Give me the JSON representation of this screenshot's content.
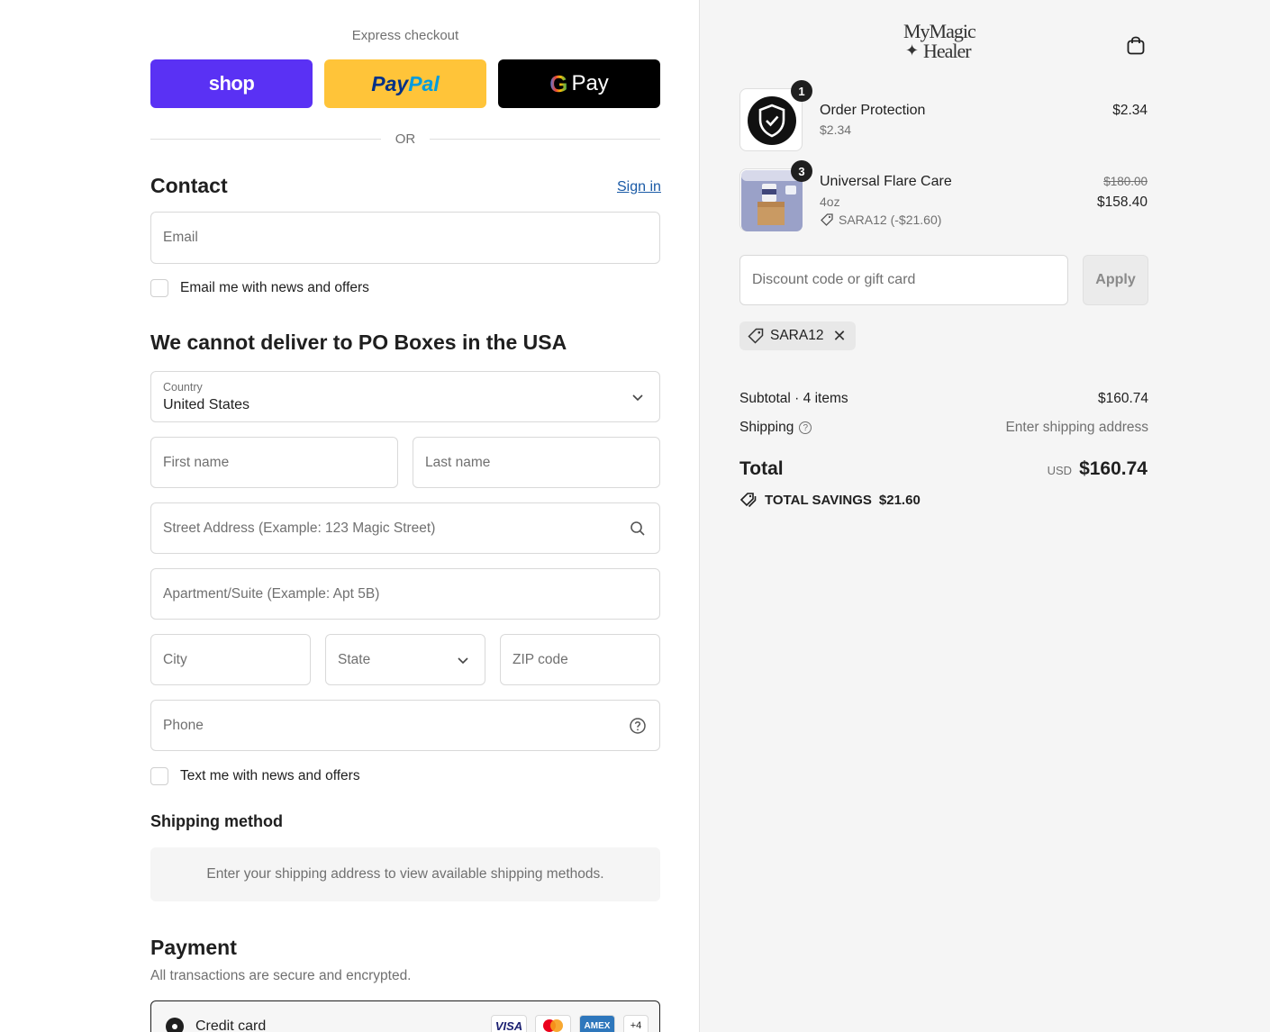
{
  "express": {
    "title": "Express checkout",
    "shop_label": "shop",
    "paypal_1": "Pay",
    "paypal_2": "Pal",
    "gpay_g": "G",
    "gpay_label": "Pay",
    "or": "OR"
  },
  "contact": {
    "title": "Contact",
    "sign_in": "Sign in",
    "email_placeholder": "Email",
    "newsletter_label": "Email me with news and offers"
  },
  "delivery": {
    "title": "We cannot deliver to PO Boxes in the USA",
    "country_label": "Country",
    "country_value": "United States",
    "first_name": "First name",
    "last_name": "Last name",
    "street": "Street Address (Example: 123 Magic Street)",
    "apartment": "Apartment/Suite (Example: Apt 5B)",
    "city": "City",
    "state": "State",
    "zip": "ZIP code",
    "phone": "Phone",
    "sms_label": "Text me with news and offers"
  },
  "shipping_method": {
    "title": "Shipping method",
    "message": "Enter your shipping address to view available shipping methods."
  },
  "payment": {
    "title": "Payment",
    "subtitle": "All transactions are secure and encrypted.",
    "credit_card_label": "Credit card",
    "cards": [
      "VISA",
      "",
      "AMEX",
      "+4"
    ]
  },
  "brand": {
    "line1": "MyMagic",
    "line2": "Healer"
  },
  "cart": {
    "items": [
      {
        "qty": "1",
        "name": "Order Protection",
        "sub": "$2.34",
        "price": "$2.34"
      },
      {
        "qty": "3",
        "name": "Universal Flare Care",
        "sub": "4oz",
        "discount": "SARA12 (-$21.60)",
        "original_price": "$180.00",
        "price": "$158.40"
      }
    ],
    "discount_placeholder": "Discount code or gift card",
    "apply_label": "Apply",
    "applied_code": "SARA12",
    "subtotal_label": "Subtotal · 4 items",
    "subtotal_value": "$160.74",
    "shipping_label": "Shipping",
    "shipping_value": "Enter shipping address",
    "total_label": "Total",
    "currency": "USD",
    "total_value": "$160.74",
    "savings_label": "TOTAL SAVINGS",
    "savings_value": "$21.60"
  },
  "colors": {
    "shop": "#5a31f4",
    "paypal": "#ffc439",
    "gpay": "#000000",
    "link": "#1a5aa6"
  }
}
